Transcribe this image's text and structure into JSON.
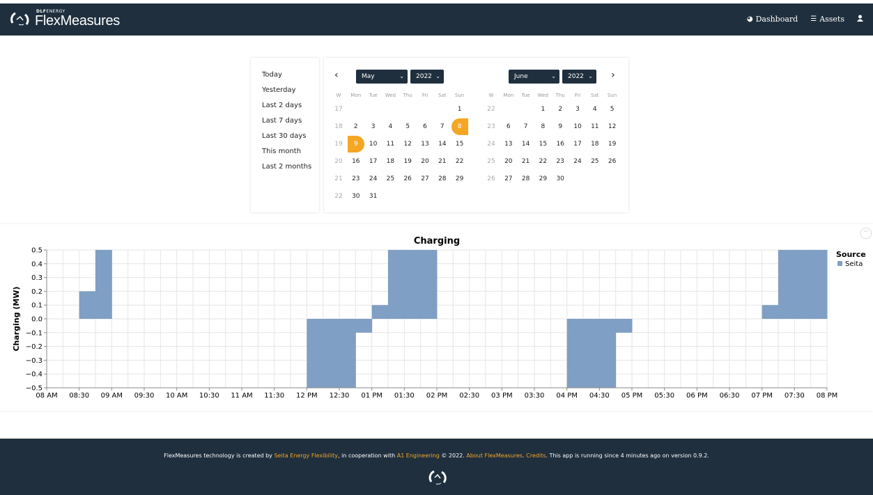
{
  "navbar": {
    "brand_sup_bold": "DLF",
    "brand_sup": "ENERGY",
    "brand_name": "FlexMeasures",
    "dashboard_label": "Dashboard",
    "assets_label": "Assets",
    "icons": [
      "dashboard-icon",
      "list-icon",
      "user-icon"
    ]
  },
  "presets": [
    "Today",
    "Yesterday",
    "Last 2 days",
    "Last 7 days",
    "Last 30 days",
    "This month",
    "Last 2 months"
  ],
  "calendar": {
    "left_month": "May",
    "left_year": "2022",
    "right_month": "June",
    "right_year": "2022",
    "weekday_headers": [
      "W",
      "Mon",
      "Tue",
      "Wed",
      "Thu",
      "Fri",
      "Sat",
      "Sun"
    ],
    "may_weeks": [
      [
        "17",
        "",
        "",
        "",
        "",
        "",
        "",
        "1"
      ],
      [
        "18",
        "2",
        "3",
        "4",
        "5",
        "6",
        "7",
        "8"
      ],
      [
        "19",
        "9",
        "10",
        "11",
        "12",
        "13",
        "14",
        "15"
      ],
      [
        "20",
        "16",
        "17",
        "18",
        "19",
        "20",
        "21",
        "22"
      ],
      [
        "21",
        "23",
        "24",
        "25",
        "26",
        "27",
        "28",
        "29"
      ],
      [
        "22",
        "30",
        "31",
        "",
        "",
        "",
        "",
        ""
      ]
    ],
    "june_weeks": [
      [
        "22",
        "",
        "",
        "1",
        "2",
        "3",
        "4",
        "5"
      ],
      [
        "23",
        "6",
        "7",
        "8",
        "9",
        "10",
        "11",
        "12"
      ],
      [
        "24",
        "13",
        "14",
        "15",
        "16",
        "17",
        "18",
        "19"
      ],
      [
        "25",
        "20",
        "21",
        "22",
        "23",
        "24",
        "25",
        "26"
      ],
      [
        "26",
        "27",
        "28",
        "29",
        "30",
        "",
        "",
        ""
      ]
    ],
    "selected_start": "8",
    "selected_end": "9",
    "accent": "#f5a623"
  },
  "chart_data": {
    "type": "area",
    "title": "Charging",
    "ylabel": "Charging (MW)",
    "xlabel": "",
    "ylim": [
      -0.5,
      0.5
    ],
    "yticks": [
      "0.5",
      "0.4",
      "0.3",
      "0.2",
      "0.1",
      "0.0",
      "−0.1",
      "−0.2",
      "−0.3",
      "−0.4",
      "−0.5"
    ],
    "xticks": [
      "08 AM",
      "08:30",
      "09 AM",
      "09:30",
      "10 AM",
      "10:30",
      "11 AM",
      "11:30",
      "12 PM",
      "12:30",
      "01 PM",
      "01:30",
      "02 PM",
      "02:30",
      "03 PM",
      "03:30",
      "04 PM",
      "04:30",
      "05 PM",
      "05:30",
      "06 PM",
      "06:30",
      "07 PM",
      "07:30",
      "08 PM"
    ],
    "x_range": [
      "08:00",
      "20:00"
    ],
    "step_minutes": 15,
    "series": [
      {
        "name": "Seita",
        "color": "#7f9fc4",
        "points": [
          {
            "start": "08:30",
            "value": 0.2
          },
          {
            "start": "08:45",
            "value": 0.5
          },
          {
            "start": "12:00",
            "value": -0.5
          },
          {
            "start": "12:15",
            "value": -0.5
          },
          {
            "start": "12:30",
            "value": -0.5
          },
          {
            "start": "12:45",
            "value": -0.1
          },
          {
            "start": "13:00",
            "value": 0.1
          },
          {
            "start": "13:15",
            "value": 0.5
          },
          {
            "start": "13:30",
            "value": 0.5
          },
          {
            "start": "13:45",
            "value": 0.5
          },
          {
            "start": "16:00",
            "value": -0.5
          },
          {
            "start": "16:15",
            "value": -0.5
          },
          {
            "start": "16:30",
            "value": -0.5
          },
          {
            "start": "16:45",
            "value": -0.1
          },
          {
            "start": "19:00",
            "value": 0.1
          },
          {
            "start": "19:15",
            "value": 0.5
          },
          {
            "start": "19:30",
            "value": 0.5
          },
          {
            "start": "19:45",
            "value": 0.5
          }
        ]
      }
    ],
    "legend_title": "Source",
    "legend_position": "top-right",
    "grid": true
  },
  "footer": {
    "t1": "FlexMeasures technology is created by ",
    "l1": "Seita Energy Flexibility",
    "t2": ", in cooperation with ",
    "l2": "A1 Engineering",
    "t3": " © 2022. ",
    "l3": "About FlexMeasures",
    "t4": ". ",
    "l4": "Credits",
    "t5": ". This app is running since 4 minutes ago on version 0.9.2."
  }
}
